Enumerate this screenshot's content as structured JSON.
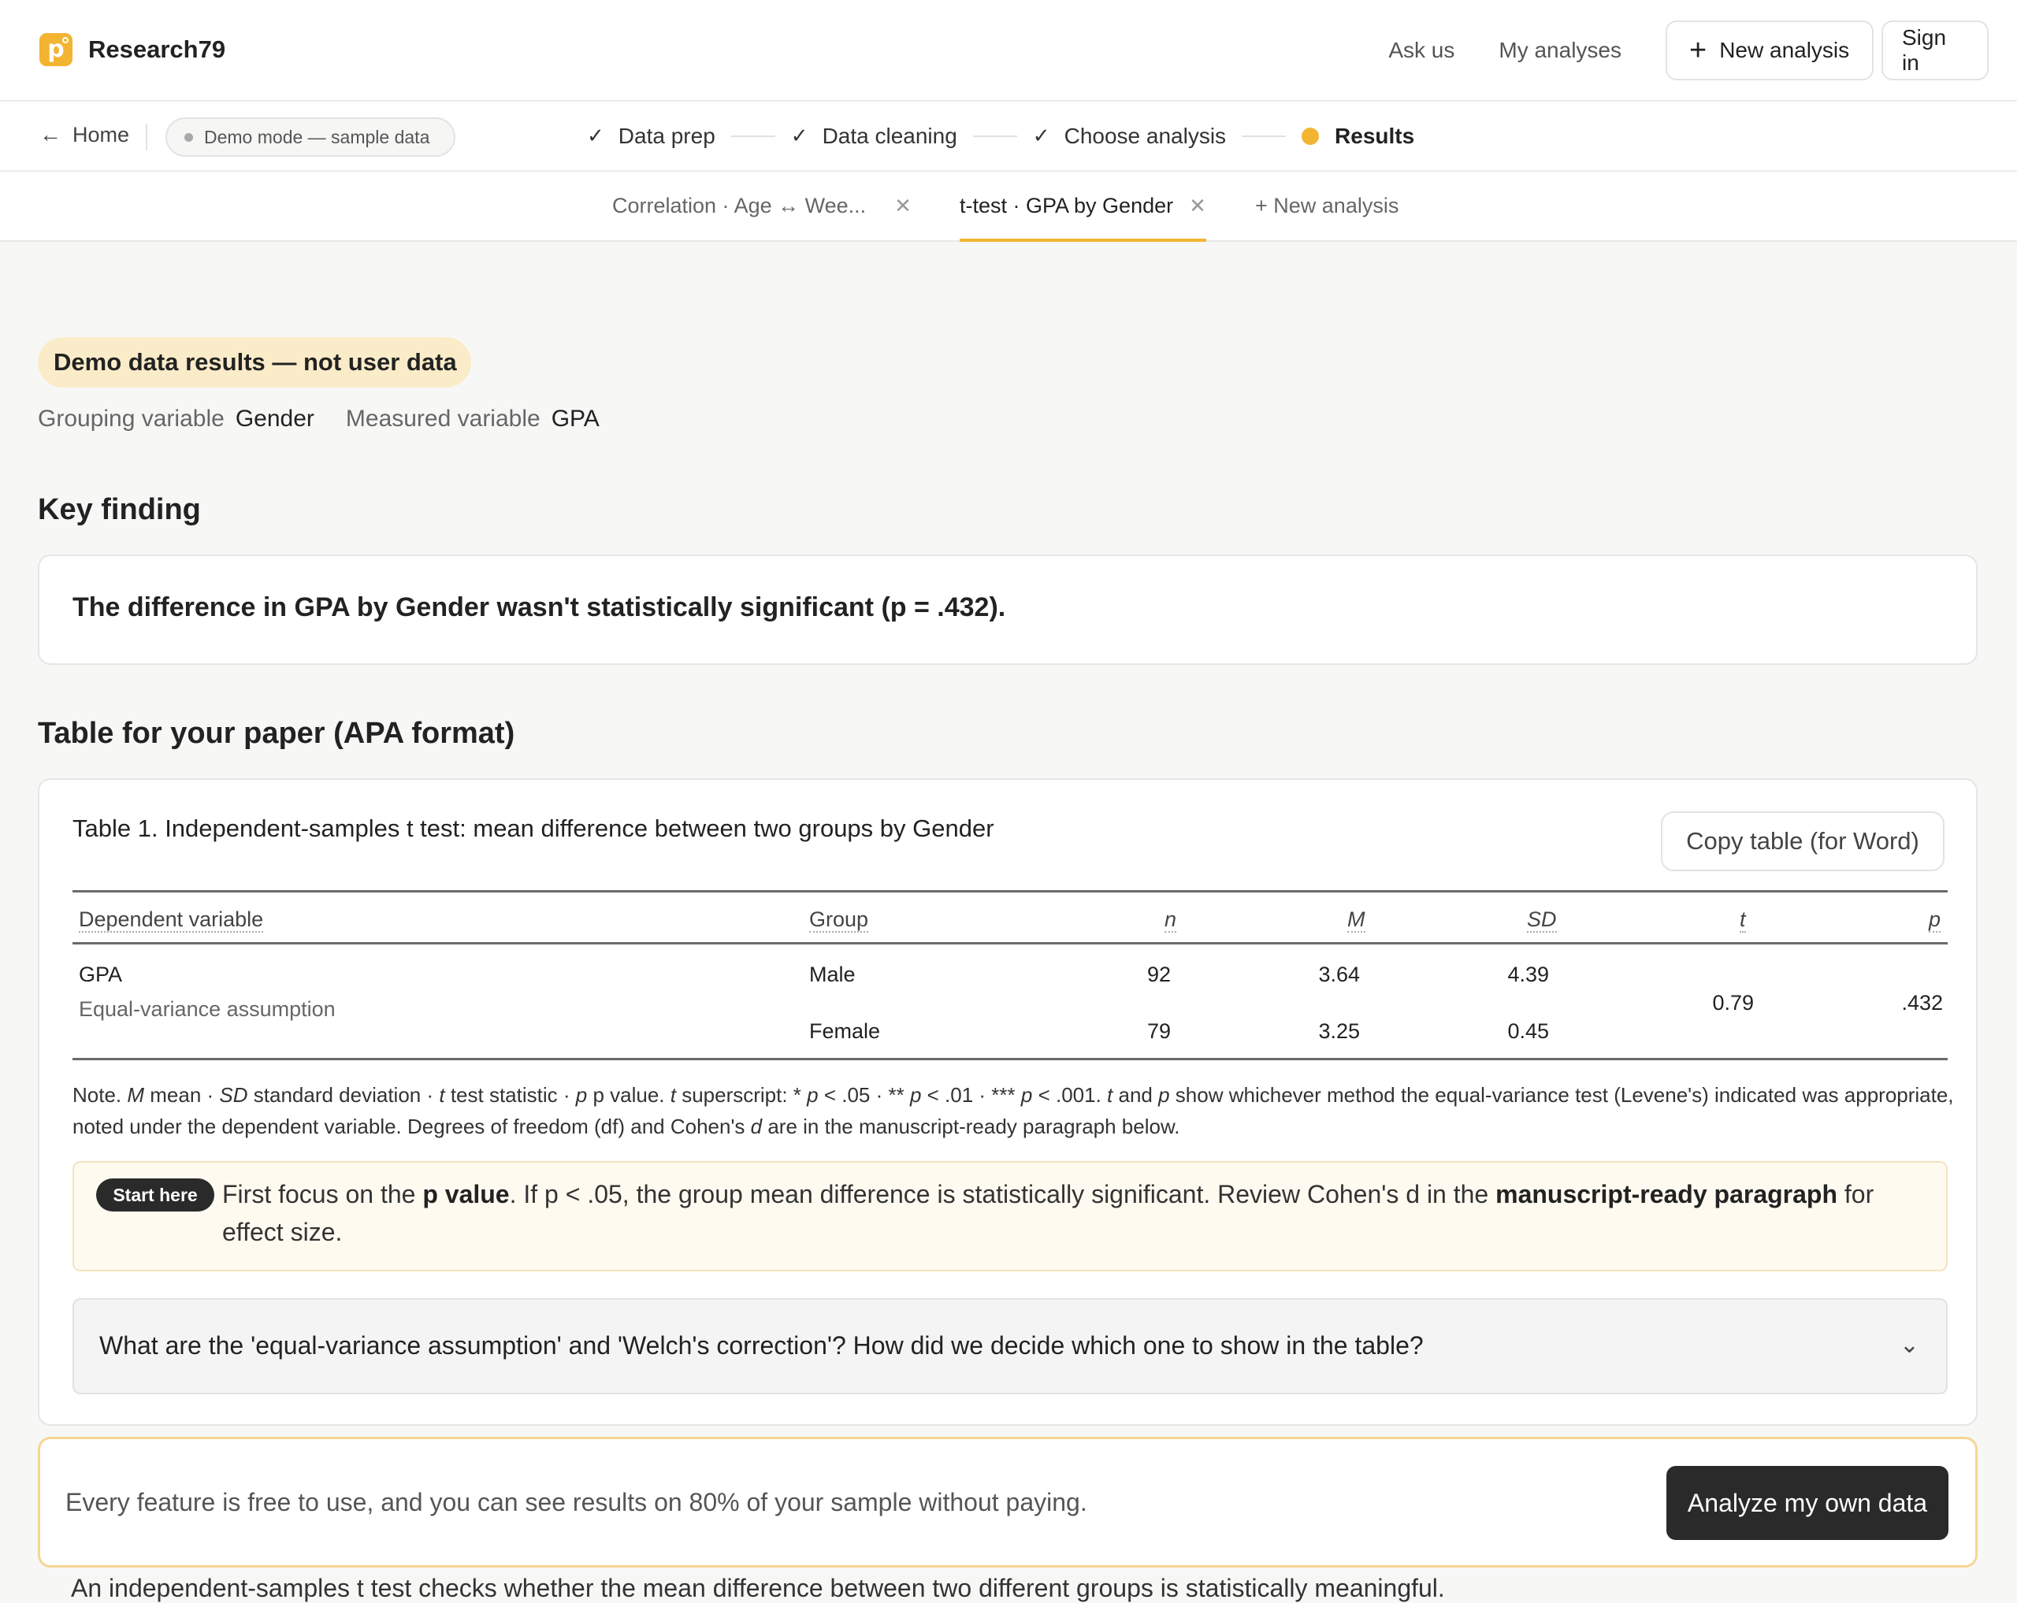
{
  "brand": {
    "name": "Research79",
    "logo_letter": "p"
  },
  "nav": {
    "ask_us": "Ask us",
    "my_analyses": "My analyses",
    "new_analysis": "New analysis",
    "sign_in": "Sign in"
  },
  "stepbar": {
    "home": "Home",
    "demo_mode": "Demo mode — sample data",
    "steps": [
      {
        "label": "Data prep",
        "state": "done"
      },
      {
        "label": "Data cleaning",
        "state": "done"
      },
      {
        "label": "Choose analysis",
        "state": "done"
      },
      {
        "label": "Results",
        "state": "active"
      }
    ]
  },
  "tabs": [
    {
      "label": "Correlation · Age ↔ Wee...",
      "active": false
    },
    {
      "label": "t-test · GPA by Gender",
      "active": true
    },
    {
      "label": "+ New analysis",
      "active": false
    }
  ],
  "badge": "Demo data results — not user data",
  "meta": {
    "grouping_label": "Grouping variable",
    "grouping_value": "Gender",
    "measured_label": "Measured variable",
    "measured_value": "GPA"
  },
  "key_finding": {
    "heading": "Key finding",
    "text": "The difference in GPA by Gender wasn't statistically significant (p = .432)."
  },
  "table_section": {
    "heading": "Table for your paper (APA format)",
    "caption": "Table 1. Independent-samples t test: mean difference between two groups by Gender",
    "copy_button": "Copy table (for Word)",
    "headers": [
      "Dependent variable",
      "Group",
      "n",
      "M",
      "SD",
      "t",
      "p"
    ],
    "row": {
      "dv": "GPA",
      "dv_note": "Equal-variance assumption",
      "groups": [
        {
          "name": "Male",
          "n": "92",
          "M": "3.64",
          "SD": "4.39"
        },
        {
          "name": "Female",
          "n": "79",
          "M": "3.25",
          "SD": "0.45"
        }
      ],
      "t": "0.79",
      "p": ".432"
    },
    "note_parts": {
      "prefix": "Note. ",
      "m_sym": "M",
      "m_txt": " mean · ",
      "sd_sym": "SD",
      "sd_txt": " standard deviation · ",
      "t_sym": "t",
      "t_txt": " test statistic · ",
      "p_sym": "p",
      "p_txt": " p value. ",
      "t_sym2": "t",
      "sup_txt": " superscript: * ",
      "p1": "p",
      "lvl1": " < .05 · ** ",
      "p2": "p",
      "lvl2": " < .01 · *** ",
      "p3": "p",
      "lvl3": " < .001. ",
      "t3": "t",
      "and": " and ",
      "p4": "p",
      "rest": " show whichever method the equal-variance test (Levene's) indicated was appropriate, noted under the dependent variable. Degrees of freedom (df) and Cohen's ",
      "d": "d",
      "end": " are in the manuscript-ready paragraph below."
    }
  },
  "start_here": {
    "pill": "Start here",
    "t1": "First focus on the ",
    "b1": "p value",
    "t2": ". If p < .05, the group mean difference is statistically significant. Review Cohen's d in the ",
    "b2": "manuscript-ready paragraph",
    "t3": " for effect size."
  },
  "faq": {
    "question": "What are the 'equal-variance assumption' and 'Welch's correction'? How did we decide which one to show in the table?"
  },
  "cta": {
    "text": "Every feature is free to use, and you can see results on 80% of your sample without paying.",
    "button": "Analyze my own data"
  },
  "clipped_text": "An independent-samples t test checks whether the mean difference between two different groups is statistically meaningful."
}
